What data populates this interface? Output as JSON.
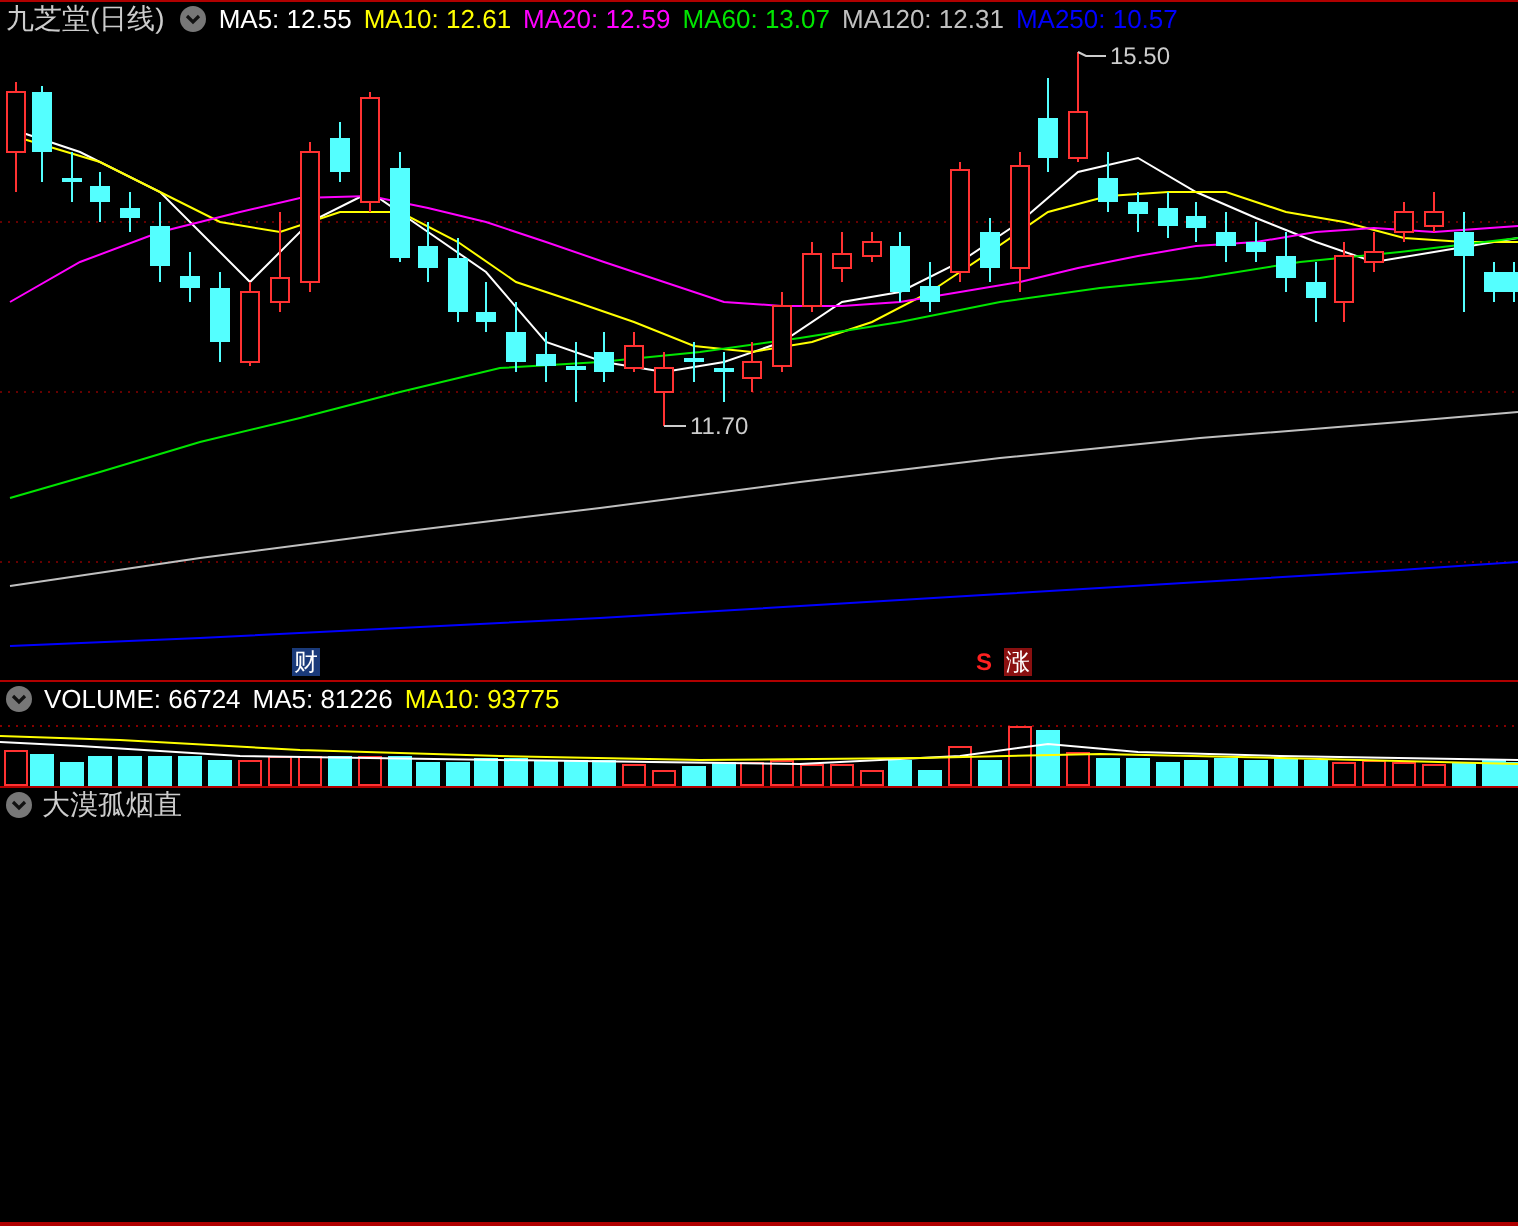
{
  "chart": {
    "title": "九芝堂(日线)",
    "indicators": [
      {
        "label": "MA5: 12.55",
        "color": "#ffffff"
      },
      {
        "label": "MA10: 12.61",
        "color": "#ffff00"
      },
      {
        "label": "MA20: 12.59",
        "color": "#ff00ff"
      },
      {
        "label": "MA60: 13.07",
        "color": "#00e600"
      },
      {
        "label": "MA120: 12.31",
        "color": "#c0c0c0"
      },
      {
        "label": "MA250: 10.57",
        "color": "#0000ff"
      }
    ],
    "annotations": [
      {
        "kind": "high",
        "text": "15.50"
      },
      {
        "kind": "low",
        "text": "11.70"
      }
    ],
    "markers": [
      {
        "kind": "finance",
        "text": "财"
      },
      {
        "kind": "signal",
        "text": "S"
      },
      {
        "kind": "limit-up",
        "text": "涨"
      }
    ]
  },
  "volume": {
    "indicators": [
      {
        "label": "VOLUME: 66724",
        "color": "#ffffff"
      },
      {
        "label": "MA5: 81226",
        "color": "#ffffff"
      },
      {
        "label": "MA10: 93775",
        "color": "#ffff00"
      }
    ]
  },
  "indicator_panel": {
    "title": "大漠孤烟直"
  }
}
